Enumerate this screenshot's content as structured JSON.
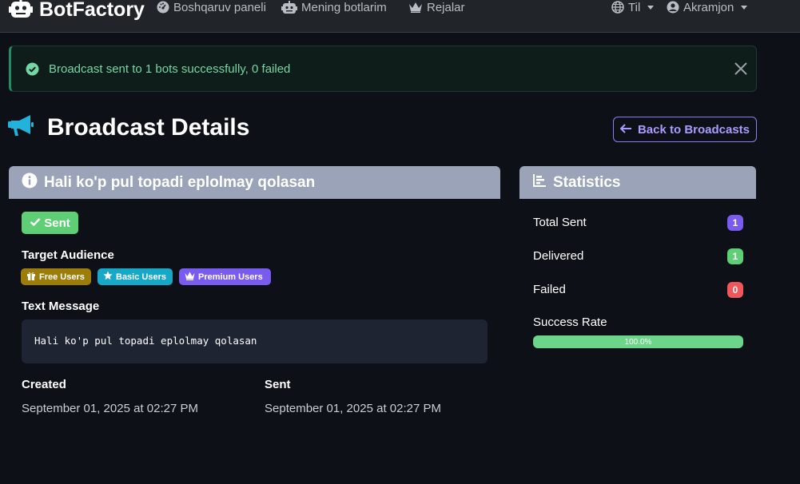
{
  "navbar": {
    "brand": "BotFactory",
    "links": [
      {
        "label": "Boshqaruv paneli",
        "icon": "dashboard-icon"
      },
      {
        "label": "Mening botlarim",
        "icon": "robot-icon"
      },
      {
        "label": "Rejalar",
        "icon": "crown-icon"
      }
    ],
    "language_label": "Til",
    "user_label": "Akramjon"
  },
  "alert": {
    "text": "Broadcast sent to 1 bots successfully, 0 failed",
    "color": "#75d6a3"
  },
  "page": {
    "title": "Broadcast Details",
    "back_button": "Back to Broadcasts"
  },
  "broadcast": {
    "header": "Hali ko'p pul topadi eplolmay qolasan",
    "status": "Sent",
    "target_audience_label": "Target Audience",
    "audiences": [
      {
        "label": "Free Users",
        "icon": "gift-icon",
        "color": "#9c7d0a"
      },
      {
        "label": "Basic Users",
        "icon": "star-icon",
        "color": "#17a8c8"
      },
      {
        "label": "Premium Users",
        "icon": "crown-icon",
        "color": "#7a5bf0"
      }
    ],
    "text_message_label": "Text Message",
    "text_message": "Hali ko'p pul topadi eplolmay qolasan",
    "created_label": "Created",
    "created_value": "September 01, 2025 at 02:27 PM",
    "sent_label": "Sent",
    "sent_value": "September 01, 2025 at 02:27 PM"
  },
  "statistics": {
    "header": "Statistics",
    "total_sent_label": "Total Sent",
    "total_sent": "1",
    "delivered_label": "Delivered",
    "delivered": "1",
    "failed_label": "Failed",
    "failed": "0",
    "success_rate_label": "Success Rate",
    "success_rate_text": "100.0%",
    "success_rate": 1.0
  }
}
